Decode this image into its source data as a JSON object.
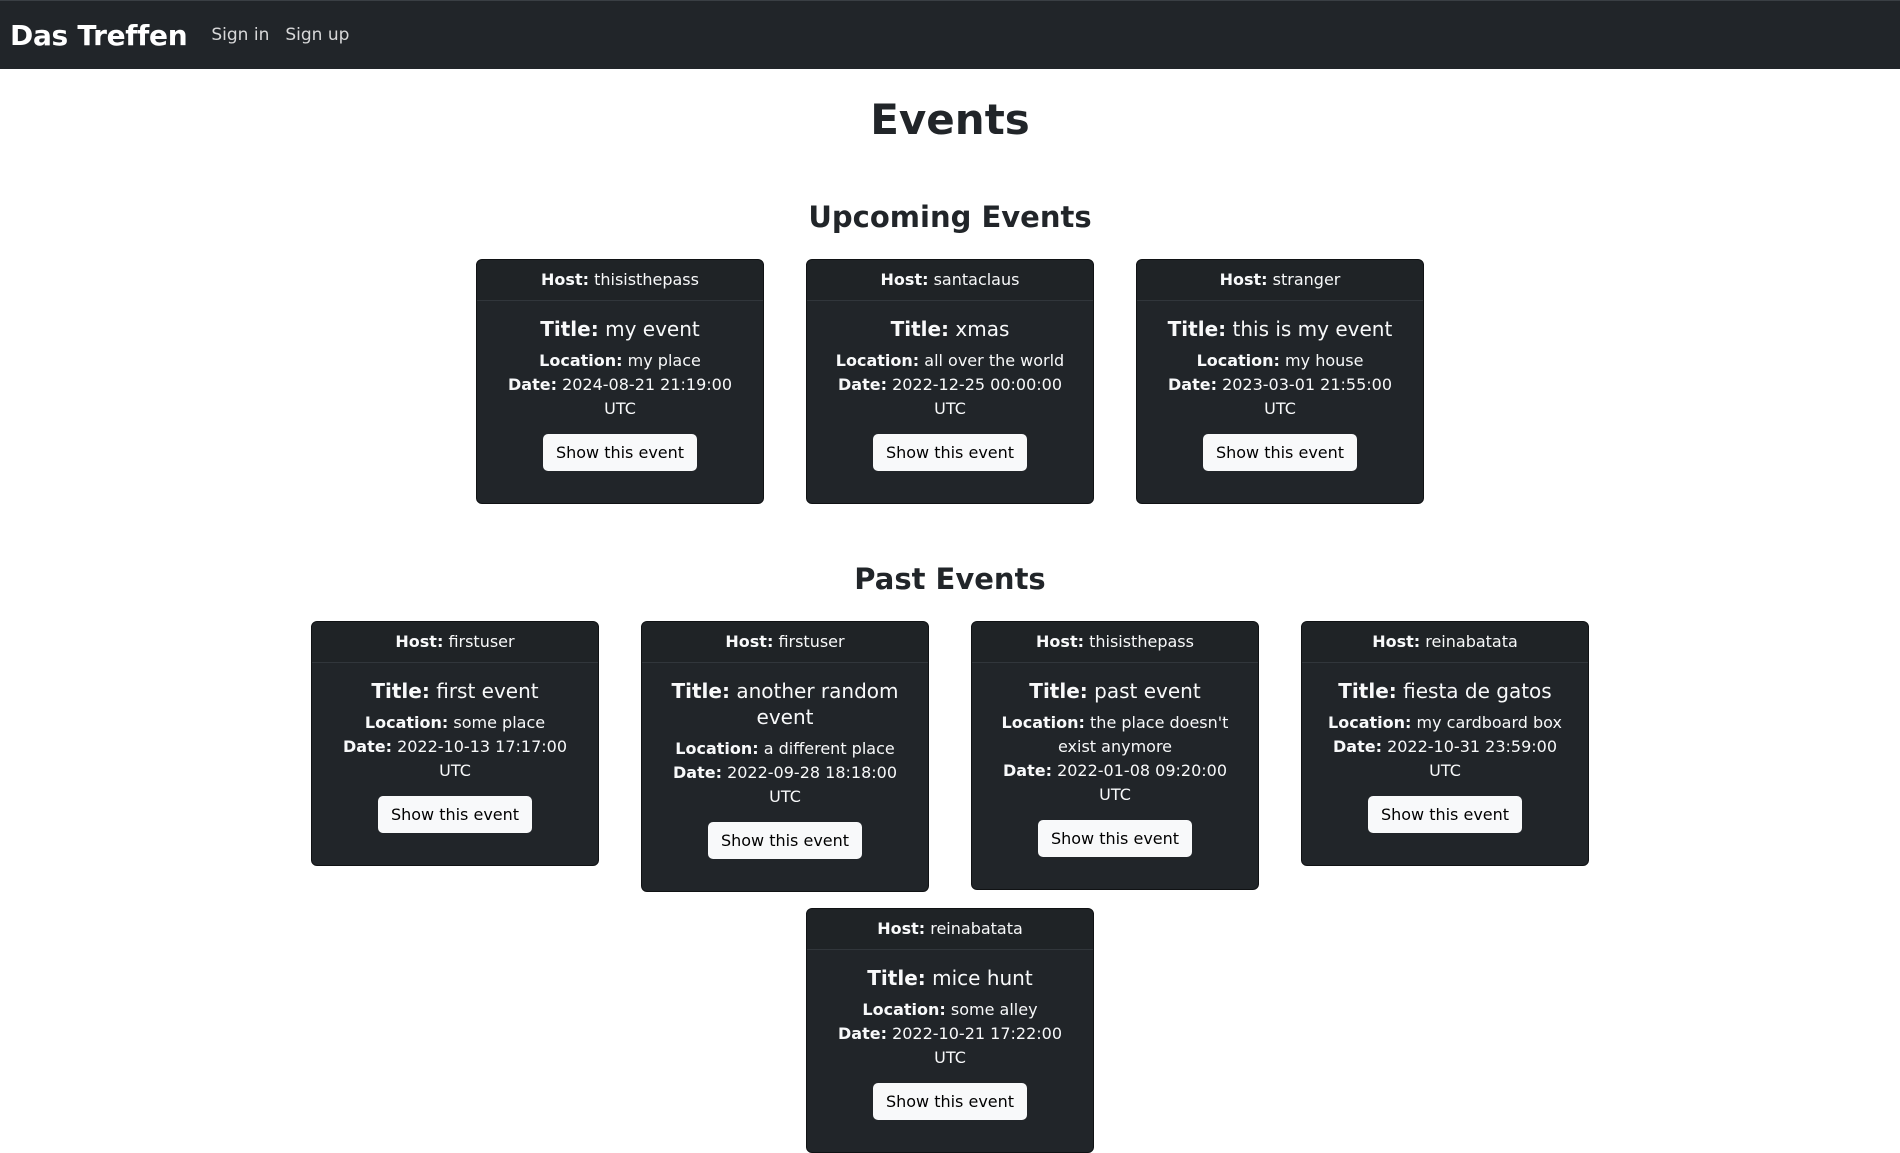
{
  "nav": {
    "brand": "Das Treffen",
    "sign_in": "Sign in",
    "sign_up": "Sign up"
  },
  "page_title": "Events",
  "labels": {
    "host": "Host:",
    "title": "Title:",
    "location": "Location:",
    "date": "Date:",
    "button": "Show this event"
  },
  "upcoming": {
    "heading": "Upcoming Events",
    "events": [
      {
        "host": "thisisthepass",
        "title": "my event",
        "location": "my place",
        "date": "2024-08-21 21:19:00 UTC"
      },
      {
        "host": "santaclaus",
        "title": "xmas",
        "location": "all over the world",
        "date": "2022-12-25 00:00:00 UTC"
      },
      {
        "host": "stranger",
        "title": "this is my event",
        "location": "my house",
        "date": "2023-03-01 21:55:00 UTC"
      }
    ]
  },
  "past": {
    "heading": "Past Events",
    "events": [
      {
        "host": "firstuser",
        "title": "first event",
        "location": "some place",
        "date": "2022-10-13 17:17:00 UTC"
      },
      {
        "host": "firstuser",
        "title": "another random event",
        "location": "a different place",
        "date": "2022-09-28 18:18:00 UTC"
      },
      {
        "host": "thisisthepass",
        "title": "past event",
        "location": "the place doesn't exist anymore",
        "date": "2022-01-08 09:20:00 UTC"
      },
      {
        "host": "reinabatata",
        "title": "fiesta de gatos",
        "location": "my cardboard box",
        "date": "2022-10-31 23:59:00 UTC"
      },
      {
        "host": "reinabatata",
        "title": "mice hunt",
        "location": "some alley",
        "date": "2022-10-21 17:22:00 UTC"
      }
    ]
  }
}
